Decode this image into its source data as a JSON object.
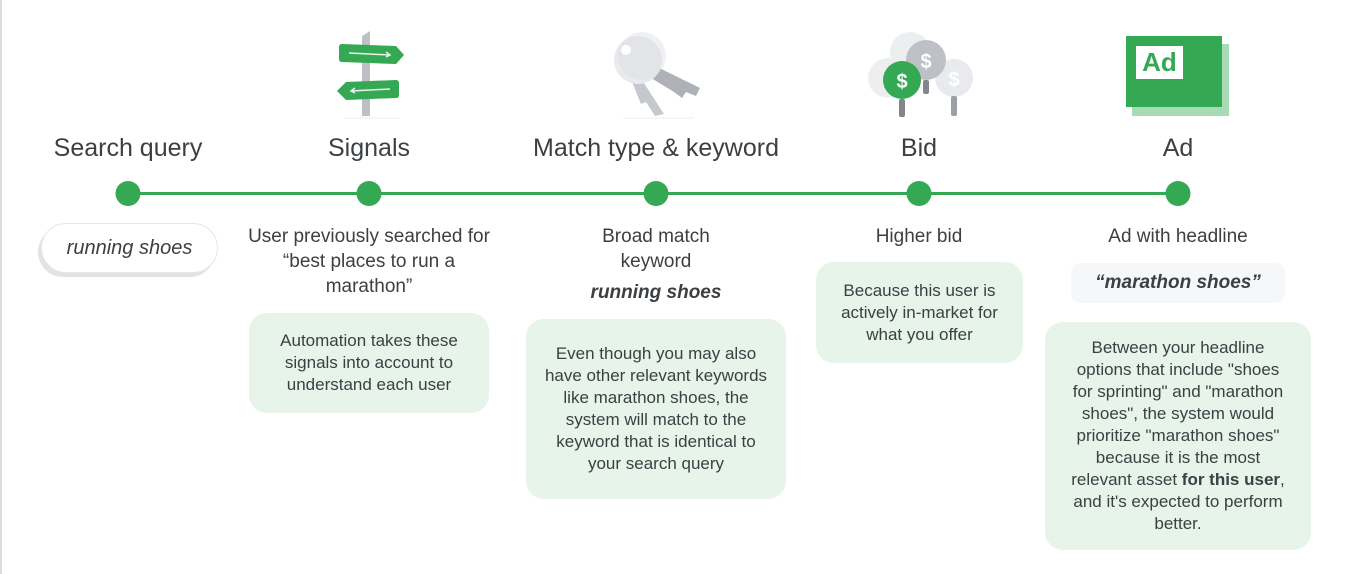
{
  "colors": {
    "accent_green": "#34a853",
    "card_green": "#e6f4ea",
    "text": "#3c4043"
  },
  "steps": [
    {
      "title": "Search query",
      "icon": "none",
      "query": "running shoes"
    },
    {
      "title": "Signals",
      "icon": "signpost-icon",
      "description": "User previously searched for “best places to run a marathon”",
      "card": "Automation takes these signals into account to understand each user"
    },
    {
      "title": "Match type & keyword",
      "icon": "keys-icon",
      "description": "Broad match keyword",
      "keyword": "running shoes",
      "card": "Even though you may also have other relevant keywords like marathon shoes, the system will match to the keyword that is identical to your search query"
    },
    {
      "title": "Bid",
      "icon": "dollar-balloons-icon",
      "description": "Higher bid",
      "card": "Because this user is actively in-market for what you offer"
    },
    {
      "title": "Ad",
      "icon": "ad-badge-icon",
      "icon_text": "Ad",
      "description": "Ad with headline",
      "headline": "“marathon shoes”",
      "card_before_bold": "Between your headline options that include \"shoes for sprinting\" and \"marathon shoes\", the system would prioritize \"marathon shoes\" because it is the most relevant asset ",
      "card_bold": "for this user",
      "card_after_bold": ", and it's expected to perform better."
    }
  ]
}
